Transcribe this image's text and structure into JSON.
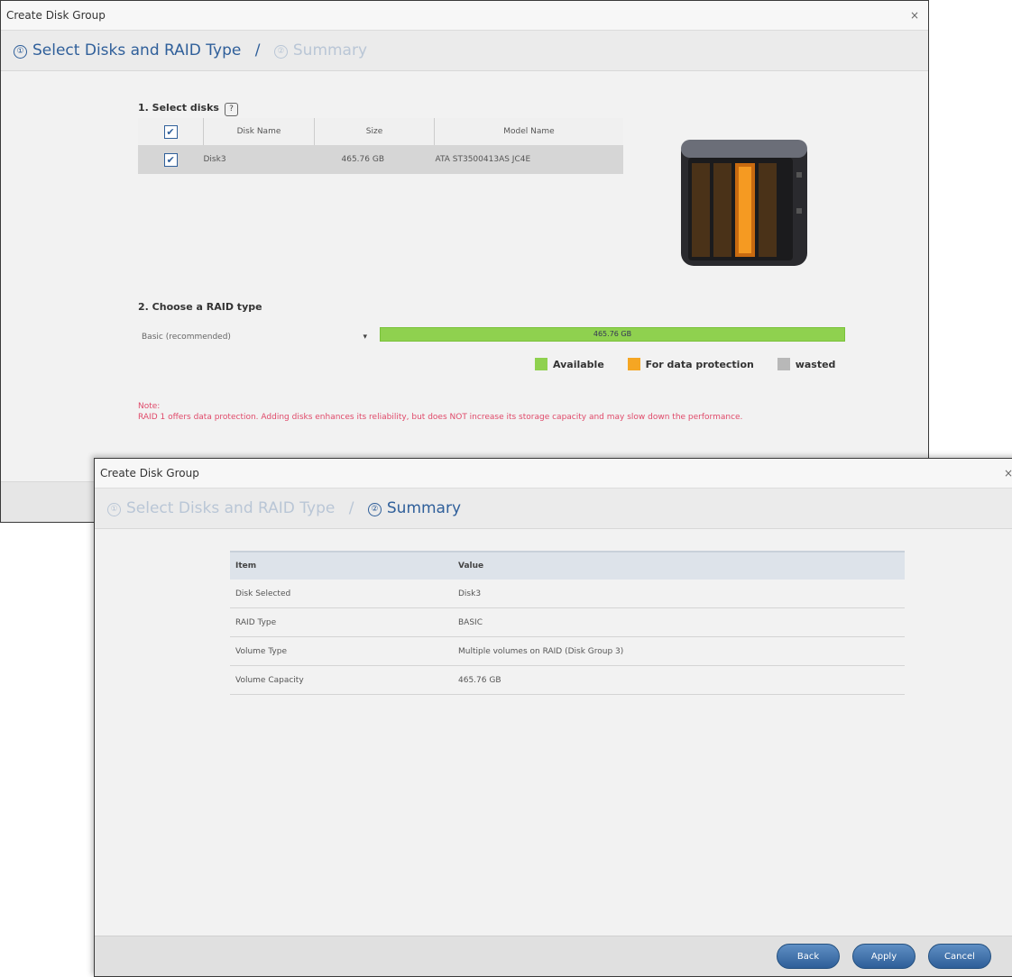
{
  "dialog1": {
    "title": "Create Disk Group",
    "steps": [
      {
        "label": "Select Disks and RAID Type",
        "marker": "①"
      },
      {
        "label": "Summary",
        "marker": "②"
      }
    ],
    "separator": "/",
    "section1_label": "1. Select disks",
    "help_icon": "?",
    "table": {
      "headers": [
        "Disk Name",
        "Size",
        "Model Name"
      ],
      "rows": [
        {
          "name": "Disk3",
          "size": "465.76 GB",
          "model": "ATA ST3500413AS JC4E"
        }
      ]
    },
    "section2_label": "2. Choose a RAID type",
    "raid_select": "Basic (recommended)",
    "capacity_bar": "465.76 GB",
    "capacity_fraction": 1.0,
    "legend": [
      {
        "label": "Available",
        "color": "#8fd14f"
      },
      {
        "label": "For data protection",
        "color": "#f5a623"
      },
      {
        "label": "wasted",
        "color": "#b8b8b8"
      }
    ],
    "note_title": "Note:",
    "note_text": "RAID 1 offers data protection. Adding disks enhances its reliability, but does NOT increase its storage capacity and may slow down the performance."
  },
  "dialog2": {
    "title": "Create Disk Group",
    "steps": [
      {
        "label": "Select Disks and RAID Type",
        "marker": "①"
      },
      {
        "label": "Summary",
        "marker": "②"
      }
    ],
    "separator": "/",
    "table_headers": [
      "Item",
      "Value"
    ],
    "rows": [
      {
        "item": "Disk Selected",
        "value": "Disk3"
      },
      {
        "item": "RAID Type",
        "value": "BASIC"
      },
      {
        "item": "Volume Type",
        "value": "Multiple volumes on RAID (Disk Group 3)"
      },
      {
        "item": "Volume Capacity",
        "value": "465.76 GB"
      }
    ],
    "buttons": {
      "back": "Back",
      "apply": "Apply",
      "cancel": "Cancel"
    }
  },
  "close_glyph": "×"
}
